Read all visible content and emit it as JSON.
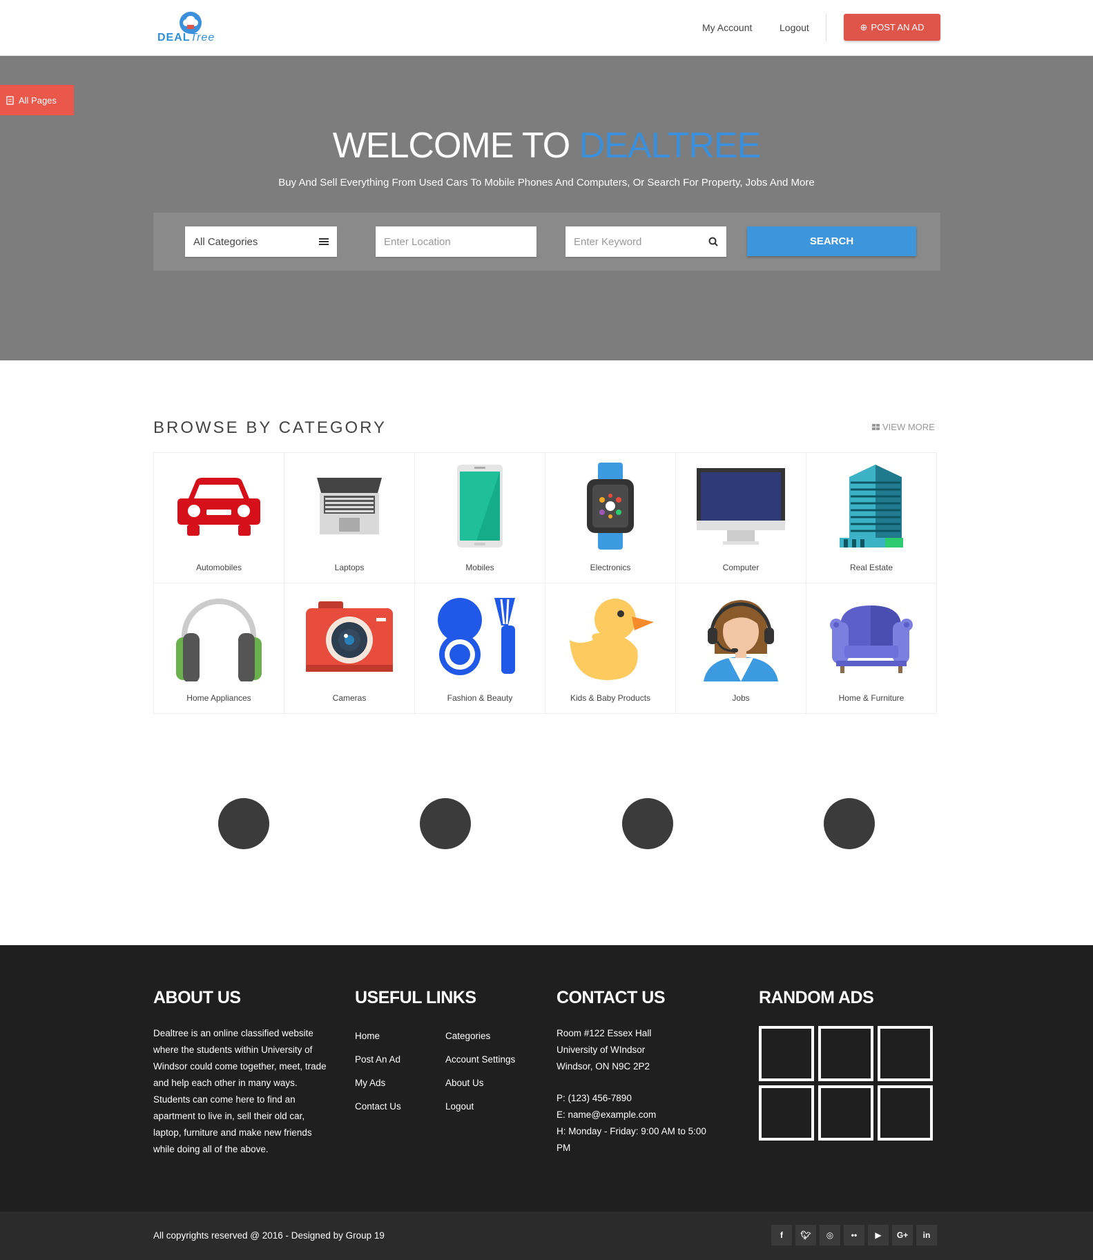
{
  "header": {
    "logo_text_a": "DEAL",
    "logo_text_b": "Tree",
    "nav": [
      "My Account",
      "Logout"
    ],
    "post_ad": "POST AN AD"
  },
  "side_tab": "All Pages",
  "hero": {
    "title_a": "WELCOME TO ",
    "title_b": "DEALTREE",
    "subtitle": "Buy And Sell Everything From Used Cars To Mobile Phones And Computers, Or Search For Property, Jobs And More",
    "category_select": "All Categories",
    "location_placeholder": "Enter Location",
    "keyword_placeholder": "Enter Keyword",
    "search_button": "SEARCH"
  },
  "categories": {
    "title": "BROWSE BY CATEGORY",
    "view_more": "VIEW MORE",
    "items": [
      {
        "label": "Automobiles",
        "icon": "car-icon"
      },
      {
        "label": "Laptops",
        "icon": "laptop-icon"
      },
      {
        "label": "Mobiles",
        "icon": "mobile-phone-icon"
      },
      {
        "label": "Electronics",
        "icon": "smartwatch-icon"
      },
      {
        "label": "Computer",
        "icon": "monitor-icon"
      },
      {
        "label": "Real Estate",
        "icon": "building-icon"
      },
      {
        "label": "Home Appliances",
        "icon": "headphones-icon"
      },
      {
        "label": "Cameras",
        "icon": "camera-icon"
      },
      {
        "label": "Fashion & Beauty",
        "icon": "makeup-brush-icon"
      },
      {
        "label": "Kids & Baby Products",
        "icon": "rubber-duck-icon"
      },
      {
        "label": "Jobs",
        "icon": "support-agent-icon"
      },
      {
        "label": "Home & Furniture",
        "icon": "armchair-icon"
      }
    ]
  },
  "footer": {
    "about_title": "ABOUT US",
    "about_text": "Dealtree is an online classified website where the students within University of Windsor could come together, meet, trade and help each other in many ways. Students can come here to find an apartment to live in, sell their old car, laptop, furniture and make new friends while doing all of the above.",
    "links_title": "USEFUL LINKS",
    "links_col1": [
      "Home",
      "Post An Ad",
      "My Ads",
      "Contact Us"
    ],
    "links_col2": [
      "Categories",
      "Account Settings",
      "About Us",
      "Logout"
    ],
    "contact_title": "CONTACT US",
    "contact_lines": [
      "Room #122 Essex Hall",
      "University of WIndsor",
      "Windsor, ON N9C 2P2"
    ],
    "phone": "P: (123) 456-7890",
    "email": "E: name@example.com",
    "hours": "H: Monday - Friday: 9:00 AM to 5:00 PM",
    "random_title": "RANDOM ADS",
    "copyright": "All copyrights reserved @ 2016 - Designed by Group 19",
    "social": [
      "f",
      "t",
      "dr",
      "fl",
      "yt",
      "G+",
      "in"
    ]
  },
  "colors": {
    "accent": "#3d96dc",
    "post": "#e05549",
    "hero": "#7d7d7d",
    "footer": "#1f1f1f"
  }
}
